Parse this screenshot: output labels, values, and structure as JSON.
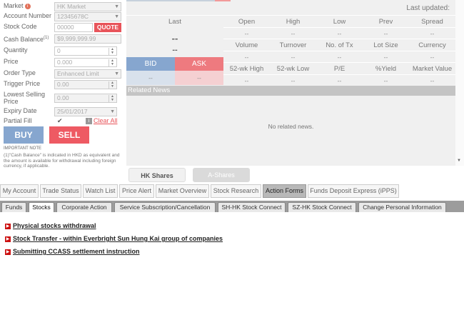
{
  "order_form": {
    "market_label": "Market",
    "market_value": "HK Market",
    "account_label": "Account Number",
    "account_value": "12345678C",
    "stock_code_label": "Stock Code",
    "stock_code_value": "00000",
    "quote_label": "QUOTE",
    "cash_balance_label": "Cash Balance",
    "cash_balance_sup": "(1)",
    "cash_balance_value": "$9,999,999.99",
    "quantity_label": "Quantity",
    "quantity_value": "0",
    "price_label": "Price",
    "price_value": "0.000",
    "order_type_label": "Order Type",
    "order_type_value": "Enhanced Limit",
    "trigger_price_label": "Trigger Price",
    "trigger_price_value": "0.00",
    "lowest_selling_label_1": "Lowest Selling",
    "lowest_selling_label_2": "Price",
    "lowest_selling_value": "0.00",
    "expiry_date_label": "Expiry Date",
    "expiry_date_value": "25/01/2017",
    "partial_fill_label": "Partial Fill",
    "partial_fill_checked": "✔",
    "clear_all_label": "Clear All",
    "buy_label": "BUY",
    "sell_label": "SELL",
    "important_note_title": "IMPORTANT NOTE",
    "important_note_text": "(1)\"Cash Balance\" is indicated in HKD as equivalent and the amount is available for withdrawal including foreign currency, if applicable."
  },
  "quote": {
    "last_updated_label": "Last updated:",
    "last_header": "Last",
    "last_value": "--",
    "change_value": "--",
    "row1_headers": [
      "Open",
      "High",
      "Low",
      "Prev",
      "Spread"
    ],
    "row1_values": [
      "--",
      "--",
      "--",
      "--",
      "--"
    ],
    "row2_headers": [
      "Volume",
      "Turnover",
      "No. of Tx",
      "Lot Size",
      "Currency"
    ],
    "row2_values": [
      "--",
      "--",
      "--",
      "--",
      "--"
    ],
    "row3_headers": [
      "52-wk High",
      "52-wk Low",
      "P/E",
      "%Yield",
      "Market Value"
    ],
    "row3_values": [
      "--",
      "--",
      "--",
      "--",
      "--"
    ],
    "bid_label": "BID",
    "ask_label": "ASK",
    "bid_value": "--",
    "ask_value": "--",
    "related_news_label": "Related News",
    "no_news_label": "No related news."
  },
  "market_tabs": {
    "hk_shares": "HK Shares",
    "a_shares": "A-Shares"
  },
  "main_nav": [
    "My Account",
    "Trade Status",
    "Watch List",
    "Price Alert",
    "Market Overview",
    "Stock Research",
    "Action Forms",
    "Funds Deposit Express (iPPS)"
  ],
  "sub_nav": [
    "Funds",
    "Stocks",
    "Corporate Action",
    "Service Subscription/Cancellation",
    "SH-HK Stock Connect",
    "SZ-HK Stock Connect",
    "Change Personal Information"
  ],
  "links": [
    "Physical stocks withdrawal",
    "Stock Transfer - within Everbright Sun Hung Kai group of companies",
    "Submitting CCASS settlement instruction"
  ],
  "colors": {
    "buy": "#86a6cf",
    "sell": "#ee5a63",
    "accent_red": "#e8545a",
    "bullet": "#cc1111"
  }
}
